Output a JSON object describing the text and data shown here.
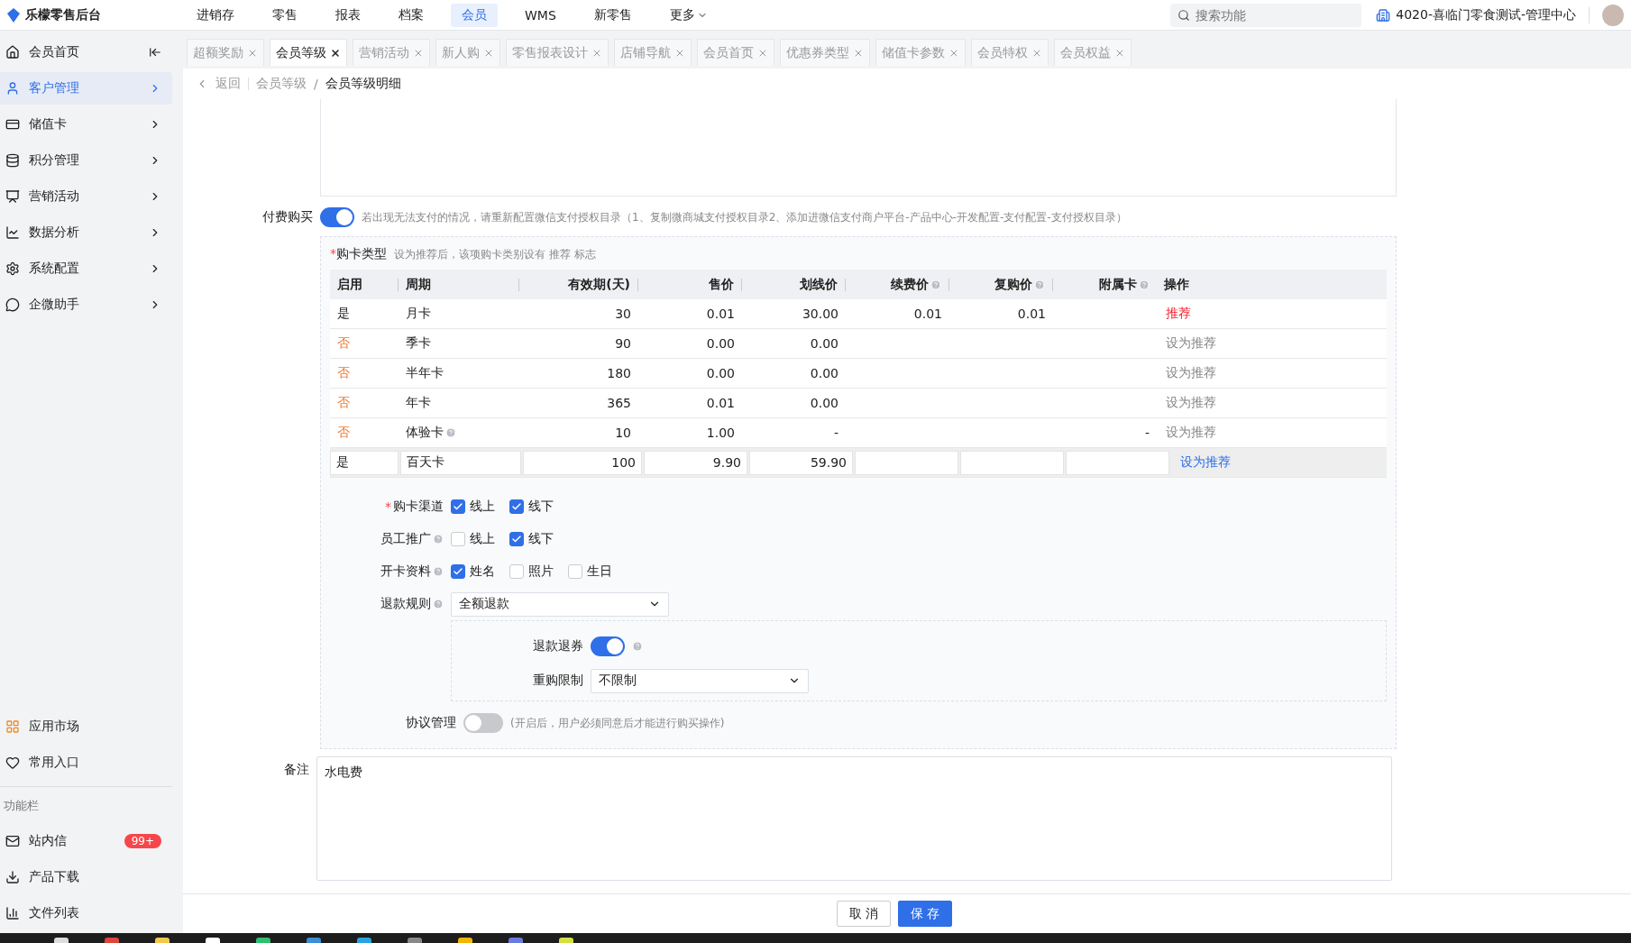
{
  "header": {
    "brand": "乐檬零售后台",
    "nav": [
      {
        "label": "进销存",
        "selected": false
      },
      {
        "label": "零售",
        "selected": false
      },
      {
        "label": "报表",
        "selected": false
      },
      {
        "label": "档案",
        "selected": false
      },
      {
        "label": "会员",
        "selected": true
      },
      {
        "label": "WMS",
        "selected": false
      },
      {
        "label": "新零售",
        "selected": false
      },
      {
        "label": "更多",
        "selected": false,
        "kind": "dropdown"
      }
    ],
    "search": {
      "placeholder": "搜索功能"
    },
    "store": "4020-喜临门零食测试-管理中心"
  },
  "sidebar": {
    "items": [
      {
        "label": "会员首页",
        "selected": false,
        "kind": "collapse"
      },
      {
        "label": "客户管理",
        "selected": true,
        "kind": "chevron"
      },
      {
        "label": "储值卡",
        "selected": false,
        "kind": "chevron"
      },
      {
        "label": "积分管理",
        "selected": false,
        "kind": "chevron"
      },
      {
        "label": "营销活动",
        "selected": false,
        "kind": "chevron"
      },
      {
        "label": "数据分析",
        "selected": false,
        "kind": "chevron"
      },
      {
        "label": "系统配置",
        "selected": false,
        "kind": "chevron"
      },
      {
        "label": "企微助手",
        "selected": false,
        "kind": "chevron"
      }
    ],
    "bottom": [
      {
        "label": "应用市场"
      },
      {
        "label": "常用入口"
      }
    ],
    "section": "功能栏",
    "tools": [
      {
        "label": "站内信",
        "badge": "99+"
      },
      {
        "label": "产品下载"
      },
      {
        "label": "文件列表"
      }
    ]
  },
  "tabs": [
    {
      "label": "超额奖励",
      "selected": false
    },
    {
      "label": "会员等级",
      "selected": true
    },
    {
      "label": "营销活动",
      "selected": false
    },
    {
      "label": "新人购",
      "selected": false
    },
    {
      "label": "零售报表设计",
      "selected": false
    },
    {
      "label": "店铺导航",
      "selected": false
    },
    {
      "label": "会员首页",
      "selected": false
    },
    {
      "label": "优惠券类型",
      "selected": false
    },
    {
      "label": "储值卡参数",
      "selected": false
    },
    {
      "label": "会员特权",
      "selected": false
    },
    {
      "label": "会员权益",
      "selected": false
    }
  ],
  "breadcrumb": {
    "back": "返回",
    "separator": "/",
    "path": [
      "会员等级",
      "会员等级明细"
    ]
  },
  "paid_purchase": {
    "label": "付费购买",
    "on": true,
    "hint": "若出现无法支付的情况，请重新配置微信支付授权目录（1、复制微商城支付授权目录2、添加进微信支付商户平台-产品中心-开发配置-支付配置-支付授权目录）"
  },
  "card_types": {
    "label": "购卡类型",
    "required_mark": "*",
    "hint": "设为推荐后，该项购卡类别设有 推荐 标志",
    "columns": [
      {
        "label": "启用",
        "help": false
      },
      {
        "label": "周期",
        "help": false
      },
      {
        "label": "有效期(天)",
        "help": false
      },
      {
        "label": "售价",
        "help": false
      },
      {
        "label": "划线价",
        "help": false
      },
      {
        "label": "续费价",
        "help": true
      },
      {
        "label": "复购价",
        "help": true
      },
      {
        "label": "附属卡",
        "help": true
      },
      {
        "label": "操作",
        "help": false
      }
    ],
    "rows": [
      {
        "kind": "view",
        "enabled": true,
        "enabled_text": "是",
        "period": "月卡",
        "period_help": false,
        "days": "30",
        "price": "0.01",
        "strike_price": "30.00",
        "renew_price": "0.01",
        "repurchase_price": "0.01",
        "addon": "",
        "action": "推荐",
        "recommended": true
      },
      {
        "kind": "view",
        "enabled": false,
        "enabled_text": "否",
        "period": "季卡",
        "period_help": false,
        "days": "90",
        "price": "0.00",
        "strike_price": "0.00",
        "renew_price": "",
        "repurchase_price": "",
        "addon": "",
        "action": "设为推荐",
        "recommended": false
      },
      {
        "kind": "view",
        "enabled": false,
        "enabled_text": "否",
        "period": "半年卡",
        "period_help": false,
        "days": "180",
        "price": "0.00",
        "strike_price": "0.00",
        "renew_price": "",
        "repurchase_price": "",
        "addon": "",
        "action": "设为推荐",
        "recommended": false
      },
      {
        "kind": "view",
        "enabled": false,
        "enabled_text": "否",
        "period": "年卡",
        "period_help": false,
        "days": "365",
        "price": "0.01",
        "strike_price": "0.00",
        "renew_price": "",
        "repurchase_price": "",
        "addon": "",
        "action": "设为推荐",
        "recommended": false
      },
      {
        "kind": "view",
        "enabled": false,
        "enabled_text": "否",
        "period": "体验卡",
        "period_help": true,
        "days": "10",
        "price": "1.00",
        "strike_price": "-",
        "renew_price": "",
        "repurchase_price": "",
        "addon": "-",
        "action": "设为推荐",
        "recommended": false
      },
      {
        "kind": "edit",
        "enabled": true,
        "enabled_text": "是",
        "period": "百天卡",
        "period_help": false,
        "days": "100",
        "price": "9.90",
        "strike_price": "59.90",
        "renew_price": "",
        "repurchase_price": "",
        "addon": "",
        "action": "设为推荐",
        "recommended": false
      }
    ]
  },
  "options": [
    {
      "label": "购卡渠道",
      "required_mark": "*",
      "help": false,
      "choices": [
        {
          "label": "线上",
          "checked": true
        },
        {
          "label": "线下",
          "checked": true
        }
      ]
    },
    {
      "label": "员工推广",
      "help": true,
      "choices": [
        {
          "label": "线上",
          "checked": false
        },
        {
          "label": "线下",
          "checked": true
        }
      ]
    },
    {
      "label": "开卡资料",
      "help": true,
      "choices": [
        {
          "label": "姓名",
          "checked": true
        },
        {
          "label": "照片",
          "checked": false
        },
        {
          "label": "生日",
          "checked": false
        }
      ]
    }
  ],
  "refund_rule": {
    "label": "退款规则",
    "help": true,
    "value": "全额退款"
  },
  "refund_coupon": {
    "label": "退款退券",
    "on": true,
    "help": true
  },
  "repurchase_limit": {
    "label": "重购限制",
    "value": "不限制"
  },
  "agreement": {
    "label": "协议管理",
    "on": false,
    "hint": "(开启后，用户必须同意后才能进行购买操作)"
  },
  "remark": {
    "label": "备注",
    "value": "水电费"
  },
  "footer": {
    "cancel": "取 消",
    "save": "保 存"
  }
}
